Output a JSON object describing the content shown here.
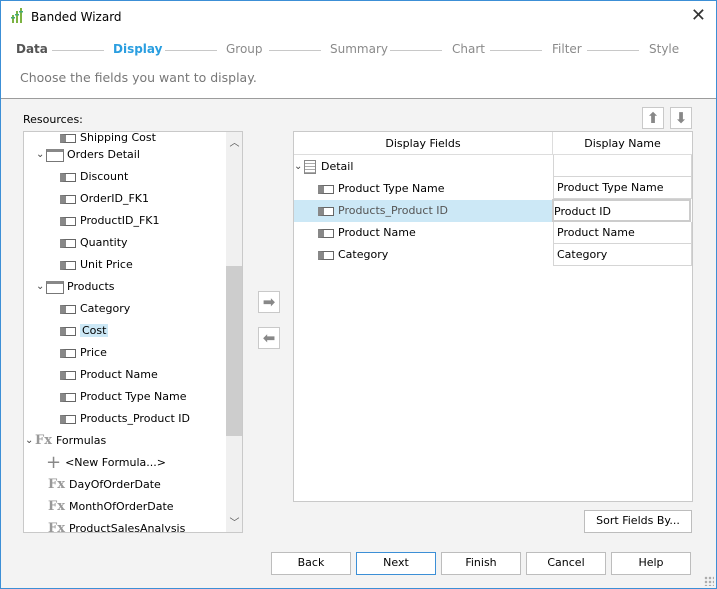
{
  "window": {
    "title": "Banded Wizard",
    "accent": "#2a9ee0"
  },
  "steps": [
    {
      "label": "Data",
      "state": "done"
    },
    {
      "label": "Display",
      "state": "active"
    },
    {
      "label": "Group",
      "state": "pending"
    },
    {
      "label": "Summary",
      "state": "pending"
    },
    {
      "label": "Chart",
      "state": "pending"
    },
    {
      "label": "Filter",
      "state": "pending"
    },
    {
      "label": "Style",
      "state": "pending"
    }
  ],
  "subtitle": "Choose the fields you want to display.",
  "resources": {
    "label": "Resources:",
    "items": [
      {
        "label": "Shipping Cost",
        "icon": "field-icon"
      },
      {
        "label": "Orders Detail",
        "icon": "table-icon",
        "expanded": true
      },
      {
        "label": "Discount",
        "icon": "field-icon"
      },
      {
        "label": "OrderID_FK1",
        "icon": "field-icon"
      },
      {
        "label": "ProductID_FK1",
        "icon": "field-icon"
      },
      {
        "label": "Quantity",
        "icon": "field-icon"
      },
      {
        "label": "Unit Price",
        "icon": "field-icon"
      },
      {
        "label": "Products",
        "icon": "table-icon",
        "expanded": true
      },
      {
        "label": "Category",
        "icon": "field-icon"
      },
      {
        "label": "Cost",
        "icon": "field-icon",
        "selected": true
      },
      {
        "label": "Price",
        "icon": "field-icon"
      },
      {
        "label": "Product Name",
        "icon": "field-icon"
      },
      {
        "label": "Product Type Name",
        "icon": "field-icon"
      },
      {
        "label": "Products_Product ID",
        "icon": "field-icon"
      },
      {
        "label": "Formulas",
        "icon": "fx-icon",
        "expanded": true
      },
      {
        "label": "<New Formula...>",
        "icon": "plus-icon"
      },
      {
        "label": "DayOfOrderDate",
        "icon": "fx-icon"
      },
      {
        "label": "MonthOfOrderDate",
        "icon": "fx-icon"
      },
      {
        "label": "ProductSalesAnalysis",
        "icon": "fx-icon"
      }
    ]
  },
  "fx_glyph": "Fx",
  "display": {
    "col_fields": "Display Fields",
    "col_name": "Display Name",
    "group": "Detail",
    "rows": [
      {
        "field": "Product Type Name",
        "name": "Product Type Name"
      },
      {
        "field": "Products_Product ID",
        "name": "Product ID",
        "selected": true
      },
      {
        "field": "Product Name",
        "name": "Product Name"
      },
      {
        "field": "Category",
        "name": "Category"
      }
    ]
  },
  "buttons": {
    "sort": "Sort Fields By...",
    "back": "Back",
    "next": "Next",
    "finish": "Finish",
    "cancel": "Cancel",
    "help": "Help"
  }
}
